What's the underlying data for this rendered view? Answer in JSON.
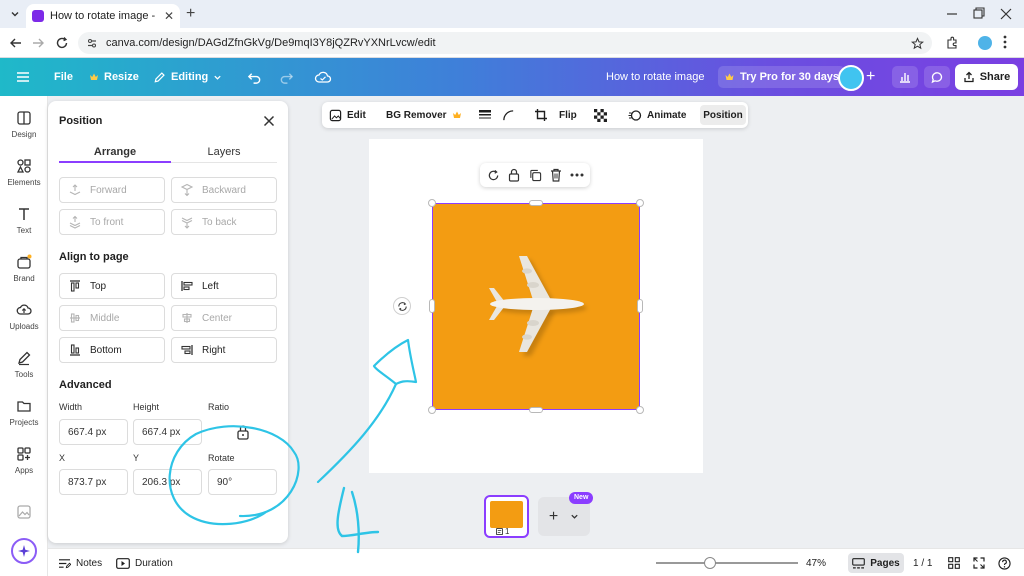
{
  "browser": {
    "tab_title": "How to rotate image - Instagram",
    "url": "canva.com/design/DAGdZfnGkVg/De9mqI3Y8jQZRvYXNrLvcw/edit",
    "new_tab_symbol": "+",
    "tab_close_symbol": "✕"
  },
  "header": {
    "file": "File",
    "resize": "Resize",
    "editing": "Editing",
    "doc_title": "How to rotate image",
    "try_pro": "Try Pro for 30 days",
    "share": "Share",
    "gradient_start": "#1fb9c9",
    "gradient_end": "#7a3fe2"
  },
  "rail": {
    "items": [
      {
        "label": "Design",
        "icon": "design-icon"
      },
      {
        "label": "Elements",
        "icon": "elements-icon"
      },
      {
        "label": "Text",
        "icon": "text-icon"
      },
      {
        "label": "Brand",
        "icon": "brand-icon"
      },
      {
        "label": "Uploads",
        "icon": "uploads-icon"
      },
      {
        "label": "Tools",
        "icon": "tools-icon"
      },
      {
        "label": "Projects",
        "icon": "projects-icon"
      },
      {
        "label": "Apps",
        "icon": "apps-icon"
      }
    ]
  },
  "panel": {
    "title": "Position",
    "tabs": [
      "Arrange",
      "Layers"
    ],
    "arrange_buttons": {
      "forward": "Forward",
      "backward": "Backward",
      "to_front": "To front",
      "to_back": "To back"
    },
    "align_title": "Align to page",
    "align_buttons": {
      "top": "Top",
      "left": "Left",
      "middle": "Middle",
      "center": "Center",
      "bottom": "Bottom",
      "right": "Right"
    },
    "advanced_title": "Advanced",
    "fields": {
      "width_label": "Width",
      "width_value": "667.4 px",
      "height_label": "Height",
      "height_value": "667.4 px",
      "ratio_label": "Ratio",
      "x_label": "X",
      "x_value": "873.7 px",
      "y_label": "Y",
      "y_value": "206.3 px",
      "rotate_label": "Rotate",
      "rotate_value": "90°"
    },
    "accent": "#8b3dff"
  },
  "context_toolbar": {
    "edit": "Edit",
    "bg_remover": "BG Remover",
    "flip": "Flip",
    "animate": "Animate",
    "position": "Position"
  },
  "canvas": {
    "image_color": "#f39c12",
    "selection_color": "#8b3dff"
  },
  "pages": {
    "thumb_number": "1",
    "new_badge": "New"
  },
  "footer": {
    "notes": "Notes",
    "duration": "Duration",
    "zoom": "47%",
    "pages": "Pages",
    "page_count": "1 / 1"
  },
  "annotation": {
    "color": "#2ec4e6",
    "handwritten": "4"
  }
}
